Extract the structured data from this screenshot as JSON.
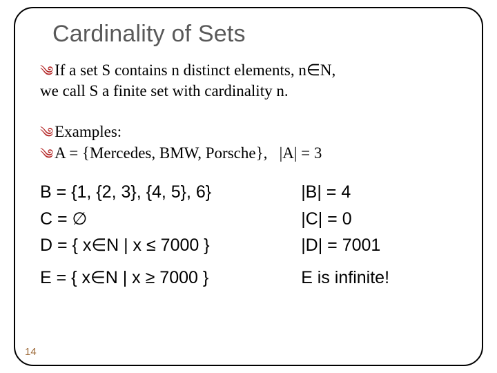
{
  "title": "Cardinality of Sets",
  "intro": {
    "line1": "If a set S contains n distinct elements, n∈N,",
    "line2": "we call S a finite set with cardinality n."
  },
  "examples_label": "Examples:",
  "example_a": {
    "def": "A = {Mercedes, BMW, Porsche},",
    "card": "|A| = 3"
  },
  "rows": {
    "b": {
      "def": "B = {1, {2, 3}, {4, 5}, 6}",
      "card": "|B| = 4"
    },
    "c": {
      "def": "C = ∅",
      "card": "|C| = 0"
    },
    "d": {
      "def": "D = { x∈N | x ≤ 7000 }",
      "card": "|D| = 7001"
    },
    "e": {
      "def": "E = { x∈N | x ≥ 7000 }",
      "card": "E is infinite!"
    }
  },
  "page_number": "14"
}
